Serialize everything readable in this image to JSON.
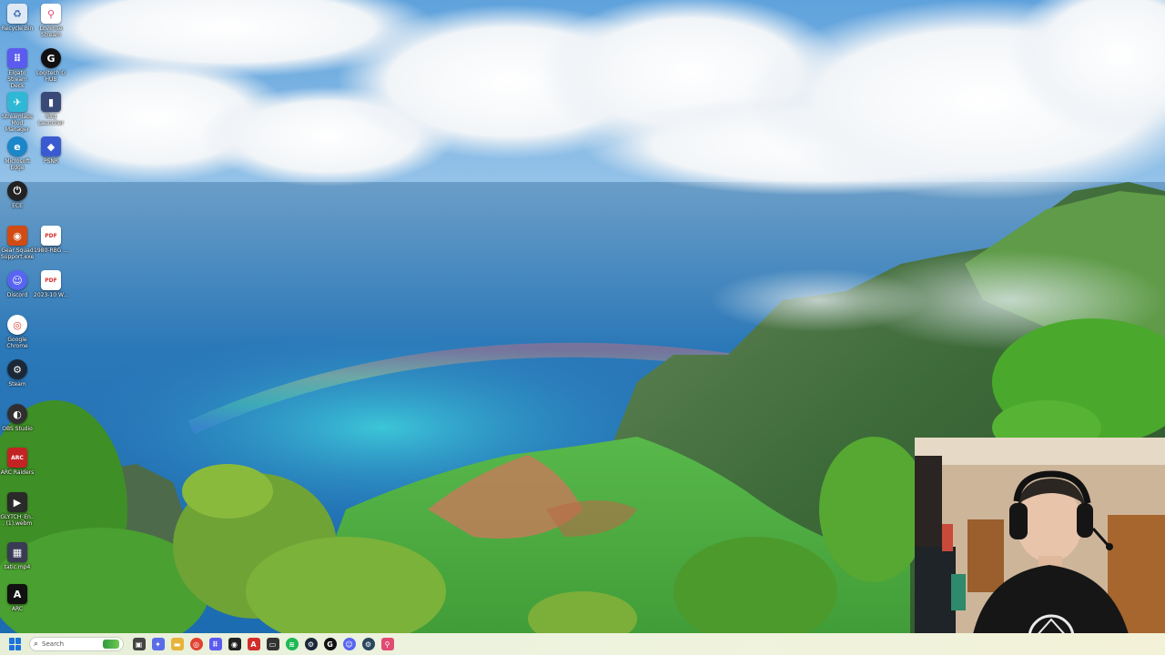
{
  "desktop": {
    "icons": [
      {
        "name": "recycle-bin-icon",
        "label": "Recycle Bin",
        "glyph": "♻",
        "color": "#dfe9f5"
      },
      {
        "name": "lovense-stream-icon",
        "label": "Lovense Stream",
        "glyph": "⚲",
        "color": "#e24a73"
      },
      {
        "name": "elgato-stream-deck-icon",
        "label": "Elgato Stream Deck",
        "glyph": "⠿",
        "color": "#5b5bf0"
      },
      {
        "name": "logitech-g-hub-icon",
        "label": "Logitech G HUB",
        "glyph": "G",
        "color": "#111111"
      },
      {
        "name": "streamlabs-icon",
        "label": "Streamlabs Mod Manager",
        "glyph": "✈",
        "color": "#2fb8d6"
      },
      {
        "name": "riot-launcher-icon",
        "label": "Riot Launcher",
        "glyph": "▮",
        "color": "#3a4a78"
      },
      {
        "name": "microsoft-edge-icon",
        "label": "Microsoft Edge",
        "glyph": "e",
        "color": "#1b86c9"
      },
      {
        "name": "psnr-icon",
        "label": "PSNR",
        "glyph": "◆",
        "color": "#3a5bd0"
      },
      {
        "name": "ece-icon",
        "label": "ECE",
        "glyph": "⏻",
        "color": "#222222"
      },
      {
        "name": "game-squad-icon",
        "label": "Gear Squad Support.exe",
        "glyph": "◉",
        "color": "#d14b12"
      },
      {
        "name": "pdf-file-icon",
        "label": "1980-RBG ...",
        "glyph": "PDF",
        "color": "#d8312b"
      },
      {
        "name": "discord-icon",
        "label": "Discord",
        "glyph": "☺",
        "color": "#5865f2"
      },
      {
        "name": "pdf-file-icon-2",
        "label": "2023-10 W...",
        "glyph": "PDF",
        "color": "#d8312b"
      },
      {
        "name": "google-chrome-icon",
        "label": "Google Chrome",
        "glyph": "◎",
        "color": "#e04232"
      },
      {
        "name": "steam-icon",
        "label": "Steam",
        "glyph": "⚙",
        "color": "#1b2838"
      },
      {
        "name": "obs-studio-icon",
        "label": "OBS Studio",
        "glyph": "◐",
        "color": "#302e31"
      },
      {
        "name": "arc-raiders-icon",
        "label": "ARC Raiders",
        "glyph": "ARC",
        "color": "#c42323"
      },
      {
        "name": "glytch-energy-icon",
        "label": "GLYTCH_En... (1).webm",
        "glyph": "▶",
        "color": "#2a2a2a"
      },
      {
        "name": "static-video-icon",
        "label": "tatic.mp4",
        "glyph": "▦",
        "color": "#3a3a55"
      },
      {
        "name": "arc-icon",
        "label": "ARC",
        "glyph": "A",
        "color": "#111111"
      }
    ]
  },
  "taskbar": {
    "search_placeholder": "Search",
    "pinned": [
      {
        "name": "task-view-icon",
        "glyph": "▣",
        "color": "#444"
      },
      {
        "name": "copilot-icon",
        "glyph": "✦",
        "color": "#5a6de8"
      },
      {
        "name": "file-explorer-icon",
        "glyph": "▬",
        "color": "#e7b43a"
      },
      {
        "name": "chrome-taskbar-icon",
        "glyph": "◎",
        "color": "#e04232"
      },
      {
        "name": "stream-deck-taskbar-icon",
        "glyph": "⠿",
        "color": "#5b5bf0"
      },
      {
        "name": "streamlabs-taskbar-icon",
        "glyph": "◉",
        "color": "#222"
      },
      {
        "name": "adobe-taskbar-icon",
        "glyph": "A",
        "color": "#d22d2d"
      },
      {
        "name": "terminal-taskbar-icon",
        "glyph": "▭",
        "color": "#333"
      },
      {
        "name": "spotify-taskbar-icon",
        "glyph": "≋",
        "color": "#1db954"
      },
      {
        "name": "steam-taskbar-icon",
        "glyph": "⚙",
        "color": "#1b2838"
      },
      {
        "name": "g-hub-taskbar-icon",
        "glyph": "G",
        "color": "#111"
      },
      {
        "name": "discord-taskbar-icon",
        "glyph": "☺",
        "color": "#5865f2"
      },
      {
        "name": "steam-2-taskbar-icon",
        "glyph": "⚙",
        "color": "#2a475e"
      },
      {
        "name": "lovense-taskbar-icon",
        "glyph": "⚲",
        "color": "#e24a73"
      }
    ]
  }
}
